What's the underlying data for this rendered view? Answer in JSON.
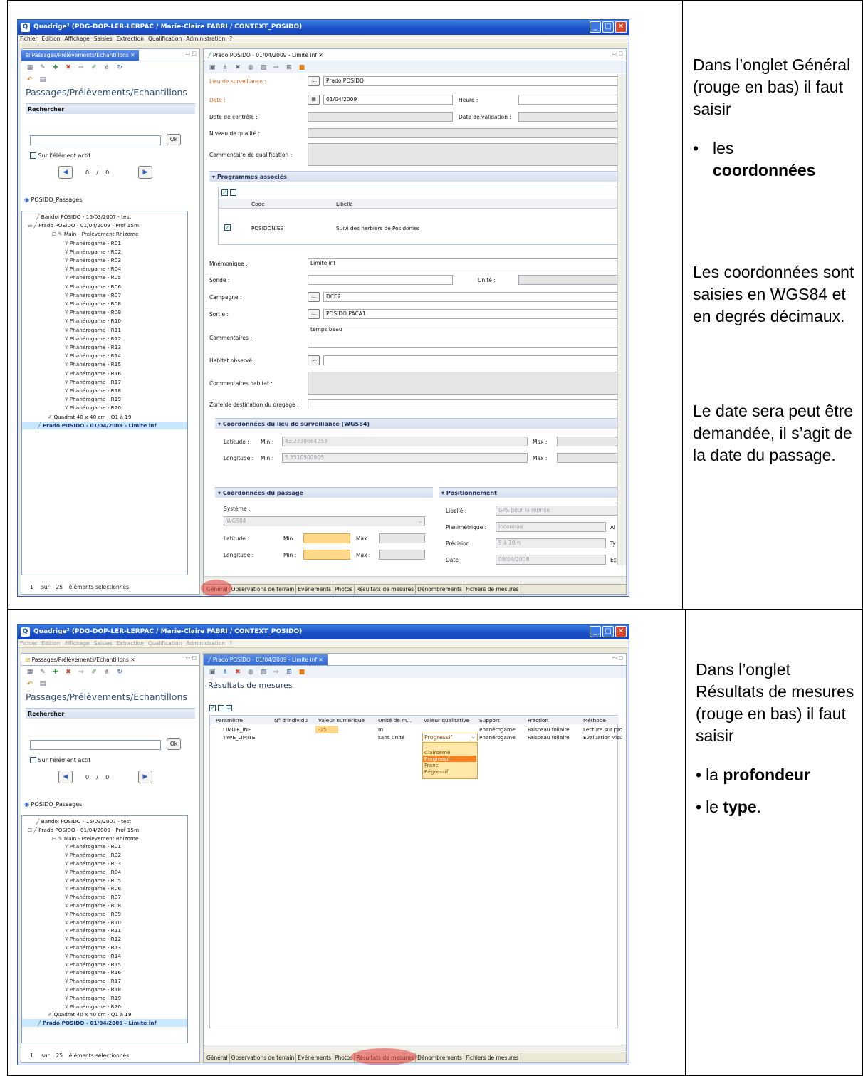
{
  "app": {
    "window_title": "Quadrige² (PDG-DOP-LER-LERPAC / Marie-Claire FABRI / CONTEXT_POSIDO)",
    "menu": [
      "Fichier",
      "Edition",
      "Affichage",
      "Saisies",
      "Extraction",
      "Qualification",
      "Administration",
      "?"
    ]
  },
  "left_panel": {
    "tab_label": "Passages/Prélèvements/Echantillons",
    "title": "Passages/Prélèvements/Echantillons",
    "search_section": "Rechercher",
    "ok_label": "Ok",
    "active_element_label": "Sur l'élément actif",
    "pager": {
      "current": "0",
      "sep": "/",
      "total": "0"
    },
    "root_label": "POSIDO_Passages",
    "tree": [
      "Bandol POSIDO - 15/03/2007 - test",
      "Prado POSIDO - 01/04/2009 - Prof 15m",
      "Main - Prelevement Rhizome",
      "Phanérogame - R01",
      "Phanérogame - R02",
      "Phanérogame - R03",
      "Phanérogame - R04",
      "Phanérogame - R05",
      "Phanérogame - R06",
      "Phanérogame - R07",
      "Phanérogame - R08",
      "Phanérogame - R09",
      "Phanérogame - R10",
      "Phanérogame - R11",
      "Phanérogame - R12",
      "Phanérogame - R13",
      "Phanérogame - R14",
      "Phanérogame - R15",
      "Phanérogame - R16",
      "Phanérogame - R17",
      "Phanérogame - R18",
      "Phanérogame - R19",
      "Phanérogame - R20",
      "Quadrat 40 x 40 cm - Q1 à 19",
      "Prado POSIDO - 01/04/2009 - Limite inf"
    ],
    "status": {
      "count": "1",
      "of": "sur",
      "total": "25",
      "label": "éléments sélectionnés."
    }
  },
  "editor": {
    "tab_label": "Prado POSIDO - 01/04/2009 - Limite inf",
    "bottom_tabs": [
      "Général",
      "Observations de terrain",
      "Evénements",
      "Photos",
      "Résultats de mesures",
      "Dénombrements",
      "Fichiers de mesures"
    ]
  },
  "general_form": {
    "lieu_label": "Lieu de surveillance :",
    "lieu_value": "Prado POSIDO",
    "date_label": "Date :",
    "date_value": "01/04/2009",
    "heure_label": "Heure :",
    "date_controle_label": "Date de contrôle :",
    "date_validation_label": "Date de validation :",
    "niveau_label": "Niveau de qualité :",
    "commentaire_qualif_label": "Commentaire de qualification :",
    "programmes_label": "Programmes associés",
    "prog_cols": [
      "Code",
      "Libellé"
    ],
    "prog_row": {
      "code": "POSIDONIES",
      "libelle": "Suivi des herbiers de Posidonies"
    },
    "mnemonique_label": "Mnémonique :",
    "mnemonique_value": "Limite inf",
    "sonde_label": "Sonde :",
    "unite_label": "Unité :",
    "campagne_label": "Campagne :",
    "campagne_value": "DCE2",
    "sortie_label": "Sortie :",
    "sortie_value": "POSIDO PACA1",
    "commentaires_label": "Commentaires :",
    "commentaires_value": "temps beau",
    "habitat_label": "Habitat observé :",
    "commentaires_habitat_label": "Commentaires habitat :",
    "zone_label": "Zone de destination du dragage :",
    "coord_lieu_label": "Coordonnées du lieu de surveillance (WGS84)",
    "latitude_label": "Latitude :",
    "longitude_label": "Longitude :",
    "min_label": "Min :",
    "max_label": "Max :",
    "lat_min": "43.2738664253",
    "lon_min": "5.3510500905",
    "coord_passage_label": "Coordonnées du passage",
    "systeme_label": "Système :",
    "systeme_value": "WGS84",
    "positionnement_label": "Positionnement",
    "libelle_label": "Libellé :",
    "libelle_value": "GPS pour la reprise",
    "planimetrique_label": "Planimétrique :",
    "planimetrique_value": "inconnue",
    "precision_label": "Précision :",
    "precision_value": "5 à 10m",
    "date2_label": "Date :",
    "date2_value": "08/04/2008",
    "al_label": "Al",
    "ty_label": "Ty",
    "ec_label": "Ec"
  },
  "results": {
    "title": "Résultats de mesures",
    "columns": [
      "Paramètre",
      "N° d'individu",
      "Valeur numérique",
      "Unité de m...",
      "Valeur qualitative",
      "Support",
      "Fraction",
      "Méthode"
    ],
    "rows": [
      [
        "LIMITE_INF",
        "",
        "-25",
        "m",
        "",
        "Phanérogame",
        "Faisceau foliaire",
        "Lecture sur pro"
      ],
      [
        "TYPE_LIMITE",
        "",
        "",
        "sans unité",
        "Progressif",
        "Phanérogame",
        "Faisceau foliaire",
        "Evaluation visu"
      ]
    ],
    "dropdown_options": [
      "Clairsemé",
      "Progressif",
      "Franc",
      "Régressif"
    ]
  },
  "notes": {
    "first": {
      "intro": "Dans l’onglet Général (rouge en bas) il faut saisir",
      "bullet": "les",
      "bullet_bold": "coordonnées",
      "coords": "Les coordonnées sont saisies en WGS84 et en degrés décimaux.",
      "date": "Le date sera peut être demandée, il s’agit de la date du passage."
    },
    "second": {
      "intro": "Dans l’onglet Résultats de mesures (rouge en bas) il faut saisir",
      "b1_pre": "la",
      "b1_bold": "profondeur",
      "b2_pre": "le",
      "b2_bold": "type",
      "b2_post": "."
    }
  }
}
